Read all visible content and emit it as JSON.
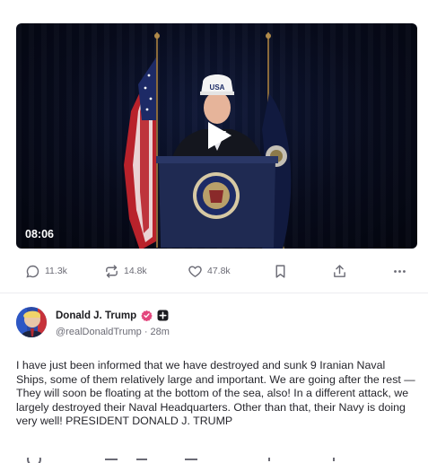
{
  "video": {
    "duration": "08:06",
    "podium_label": "USA"
  },
  "actions": {
    "replies": "11.3k",
    "restruths": "14.8k",
    "likes": "47.8k"
  },
  "post": {
    "author_name": "Donald J. Trump",
    "handle": "@realDonaldTrump",
    "separator": "·",
    "time": "28m",
    "text": "I have just been informed that we have destroyed and sunk 9 Iranian Naval Ships, some of them relatively large and important. We are going after the rest — They will soon be floating at the bottom of the sea, also! In a different attack, we largely destroyed their Naval Headquarters. Other than that, their Navy is doing very well! PRESIDENT DONALD J. TRUMP"
  },
  "colors": {
    "verified_badge": "#e3467d",
    "icon_gray": "#6b6b75",
    "video_bg": "#070b1c"
  }
}
